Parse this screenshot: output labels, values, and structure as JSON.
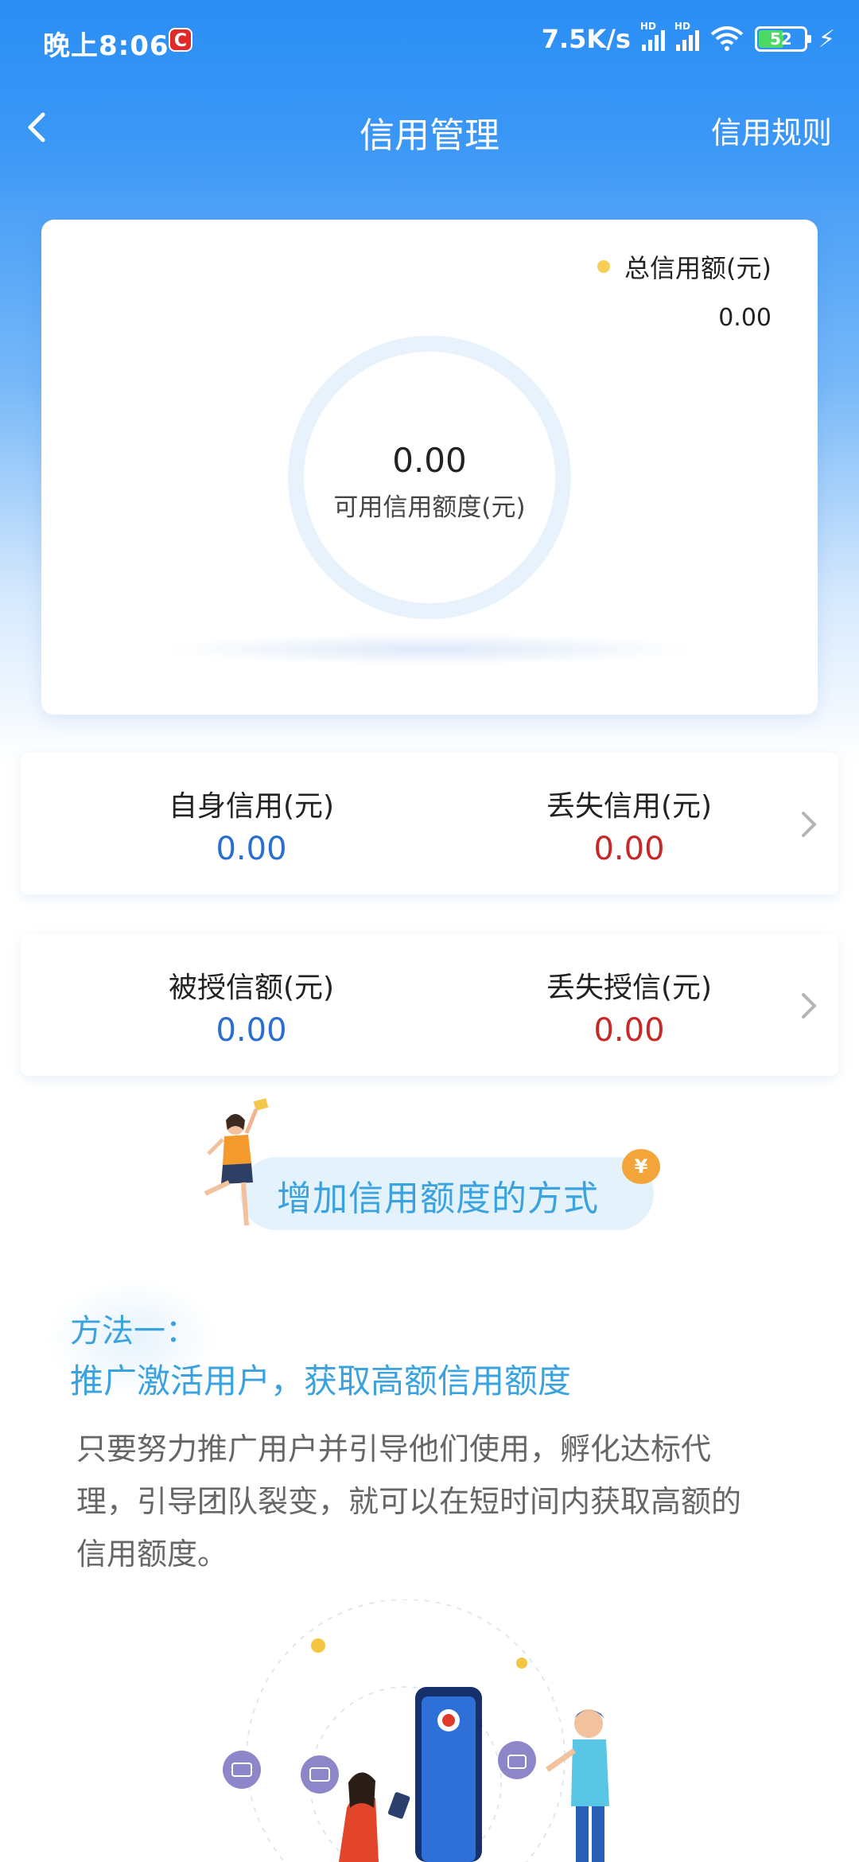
{
  "status_bar": {
    "time": "晚上8:06",
    "app_badge": "C",
    "net_speed": "7.5K/s",
    "battery": "52"
  },
  "nav": {
    "title": "信用管理",
    "rules": "信用规则"
  },
  "overview": {
    "legend_label": "总信用额(元)",
    "total_value": "0.00",
    "available_value": "0.00",
    "available_label": "可用信用额度(元)"
  },
  "row1": {
    "left_label": "自身信用(元)",
    "left_value": "0.00",
    "right_label": "丢失信用(元)",
    "right_value": "0.00"
  },
  "row2": {
    "left_label": "被授信额(元)",
    "left_value": "0.00",
    "right_label": "丢失授信(元)",
    "right_value": "0.00"
  },
  "banner": {
    "title": "增加信用额度的方式",
    "coin": "¥"
  },
  "method": {
    "title": "方法一：",
    "subtitle": "推广激活用户，获取高额信用额度",
    "description": "只要努力推广用户并引导他们使用，孵化达标代理，引导团队裂变，就可以在短时间内获取高额的信用额度。"
  },
  "colors": {
    "primary": "#2a8ef5",
    "accent_blue": "#3aa2df",
    "value_blue": "#2a6fd0",
    "value_red": "#c62828",
    "legend_dot": "#f5cf55"
  }
}
